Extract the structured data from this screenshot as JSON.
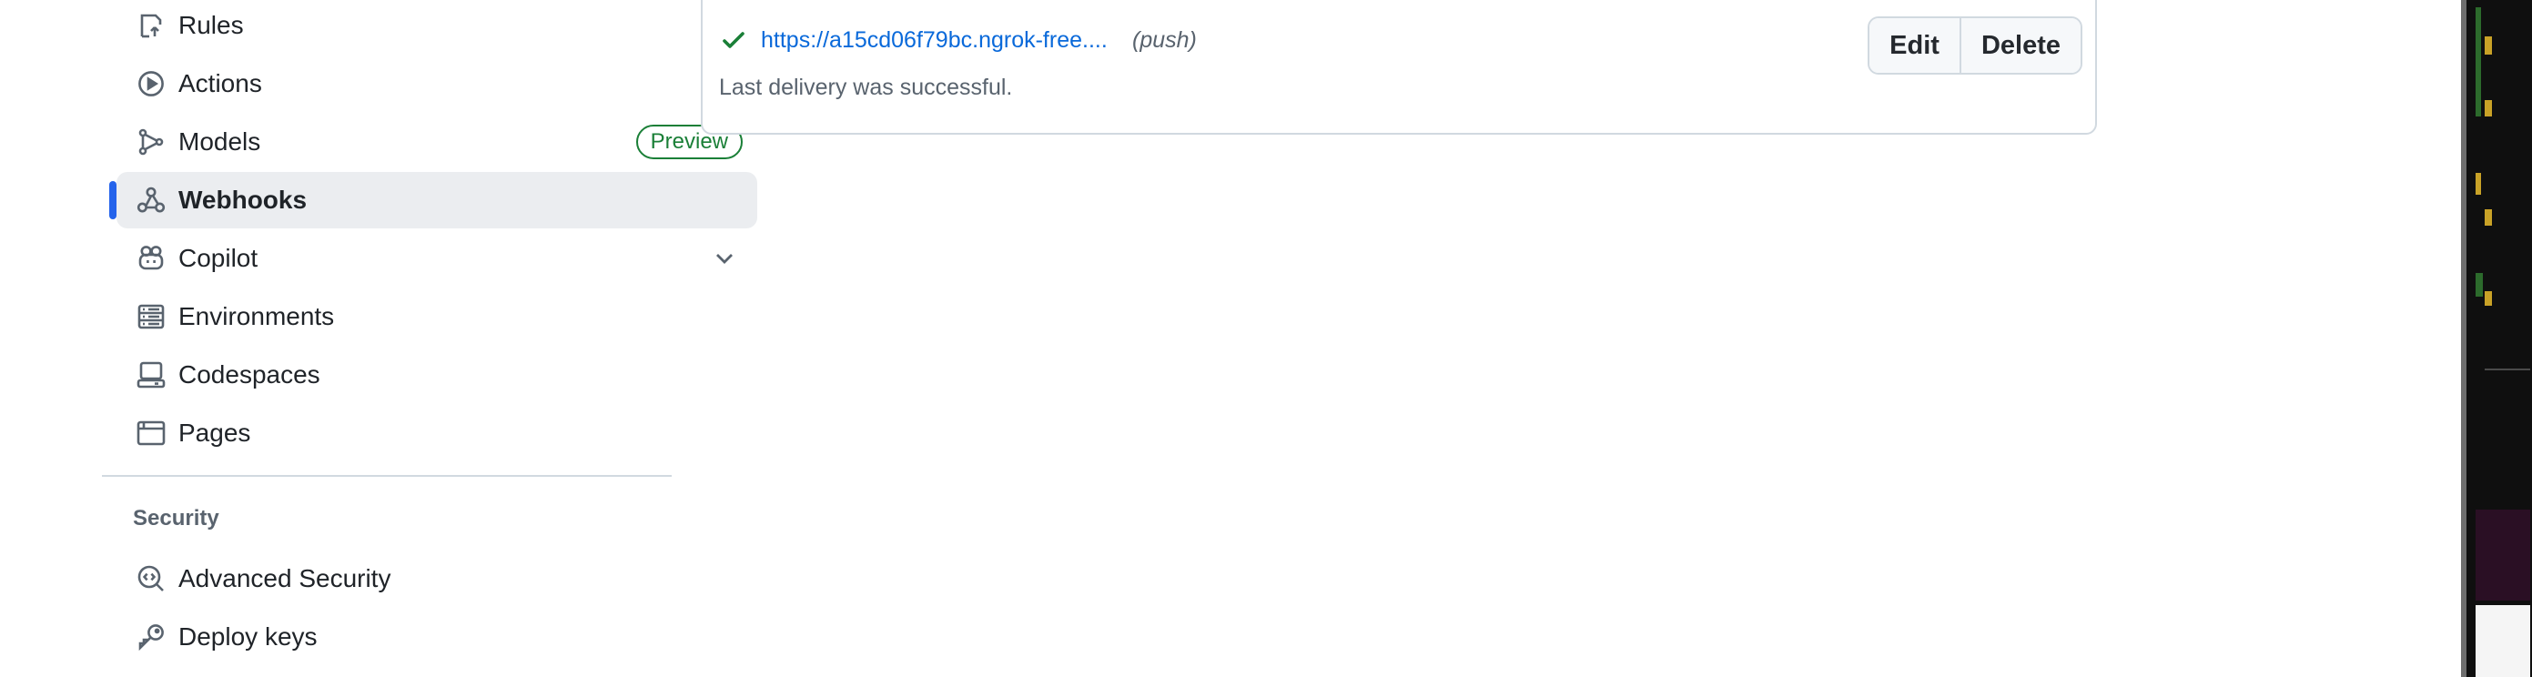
{
  "sidebar": {
    "items": [
      {
        "label": "Rules",
        "icon": "rules-icon",
        "expandable": true
      },
      {
        "label": "Actions",
        "icon": "actions-play-icon",
        "expandable": true
      },
      {
        "label": "Models",
        "icon": "models-icon",
        "badge": "Preview"
      },
      {
        "label": "Webhooks",
        "icon": "webhook-icon",
        "active": true
      },
      {
        "label": "Copilot",
        "icon": "copilot-icon",
        "expandable": true
      },
      {
        "label": "Environments",
        "icon": "server-icon"
      },
      {
        "label": "Codespaces",
        "icon": "codespaces-icon"
      },
      {
        "label": "Pages",
        "icon": "browser-icon"
      }
    ],
    "security_heading": "Security",
    "security_items": [
      {
        "label": "Advanced Security",
        "icon": "codescan-icon"
      },
      {
        "label": "Deploy keys",
        "icon": "key-icon"
      }
    ]
  },
  "webhook": {
    "url": "https://a15cd06f79bc.ngrok-free....",
    "event": "(push)",
    "status": "Last delivery was successful.",
    "edit_label": "Edit",
    "delete_label": "Delete"
  },
  "colors": {
    "accent": "#2463eb",
    "link": "#0969da",
    "success": "#1a7f37",
    "muted": "#59636e"
  }
}
